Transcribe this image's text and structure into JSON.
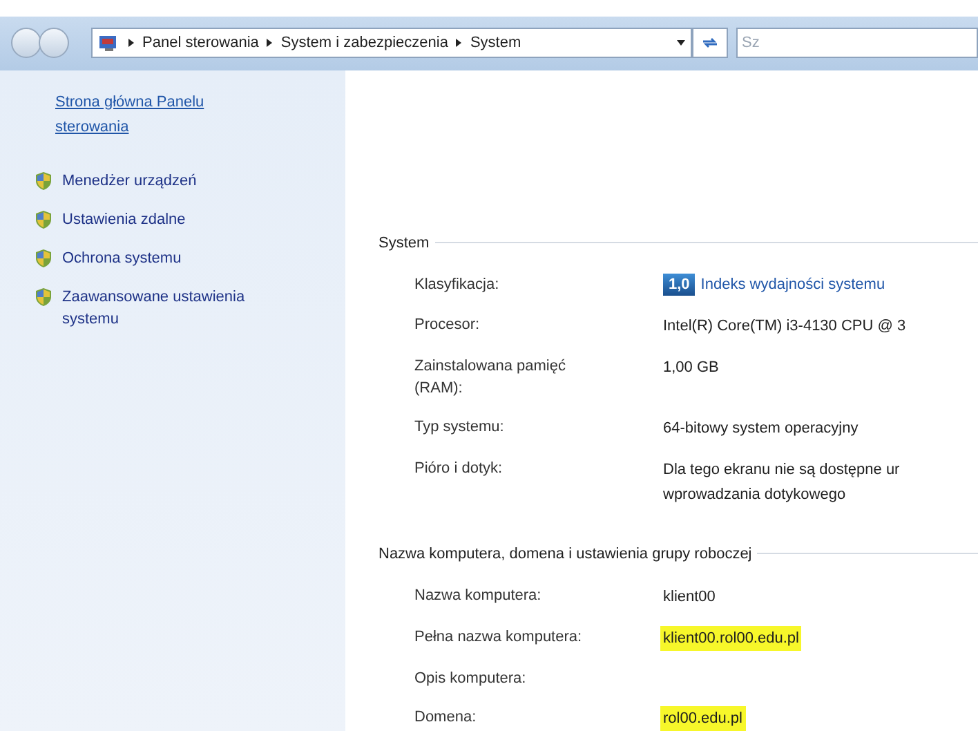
{
  "address_bar": {
    "crumbs": [
      "Panel sterowania",
      "System i zabezpieczenia",
      "System"
    ]
  },
  "search": {
    "placeholder": "Sz"
  },
  "sidebar": {
    "home_link": "Strona główna Panelu sterowania",
    "items": [
      {
        "label": "Menedżer urządzeń"
      },
      {
        "label": "Ustawienia zdalne"
      },
      {
        "label": "Ochrona systemu"
      },
      {
        "label": "Zaawansowane ustawienia systemu"
      }
    ]
  },
  "sections": [
    {
      "title": "System",
      "rows": [
        {
          "label": "Klasyfikacja:",
          "kind": "rating",
          "badge": "1,0",
          "value": "Indeks wydajności systemu"
        },
        {
          "label": "Procesor:",
          "kind": "text",
          "value": "Intel(R) Core(TM) i3-4130 CPU @ 3",
          "highlighted": false
        },
        {
          "label": "Zainstalowana pamięć (RAM):",
          "kind": "text",
          "value": "1,00 GB",
          "highlighted": false
        },
        {
          "label": "Typ systemu:",
          "kind": "text",
          "value": "64-bitowy system operacyjny",
          "highlighted": false
        },
        {
          "label": "Pióro i dotyk:",
          "kind": "text",
          "value": "Dla tego ekranu nie są dostępne ur wprowadzania dotykowego",
          "highlighted": false
        }
      ]
    },
    {
      "title": "Nazwa komputera, domena i ustawienia grupy roboczej",
      "rows": [
        {
          "label": "Nazwa komputera:",
          "kind": "text",
          "value": "klient00",
          "highlighted": false
        },
        {
          "label": "Pełna nazwa komputera:",
          "kind": "text",
          "value": "klient00.rol00.edu.pl",
          "highlighted": true
        },
        {
          "label": "Opis komputera:",
          "kind": "empty"
        },
        {
          "label": "Domena:",
          "kind": "text",
          "value": "rol00.edu.pl",
          "highlighted": true
        }
      ]
    }
  ]
}
